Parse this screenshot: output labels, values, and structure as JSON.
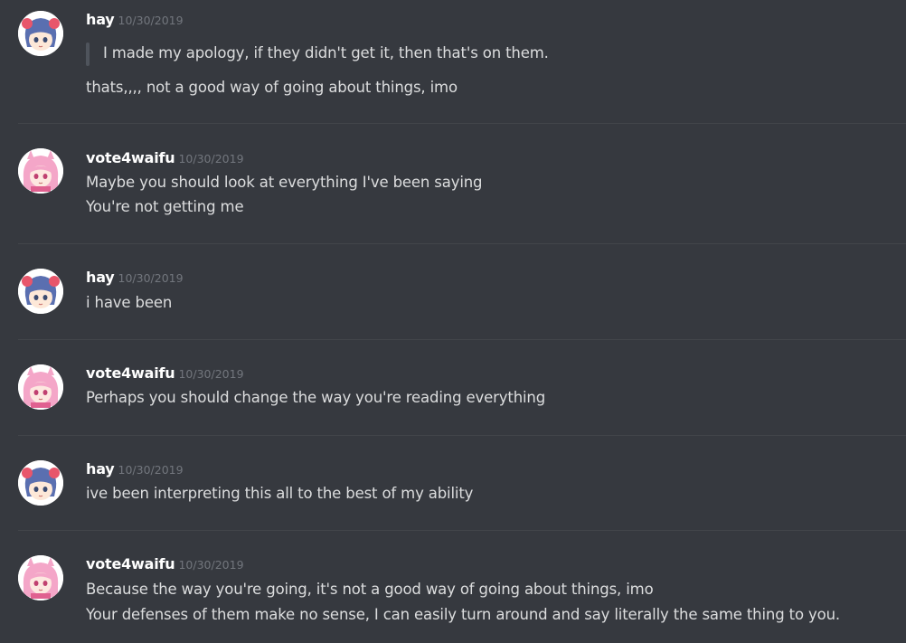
{
  "messages": [
    {
      "author": "hay",
      "timestamp": "10/30/2019",
      "avatar_icon": "hay-avatar-icon",
      "quote": "I made my apology, if they didn't get it, then that's on them.",
      "lines": [
        "thats,,,, not a good way of going about things, imo"
      ]
    },
    {
      "author": "vote4waifu",
      "timestamp": "10/30/2019",
      "avatar_icon": "vote4waifu-avatar-icon",
      "lines": [
        "Maybe you should look at everything I've been saying",
        "You're not getting me"
      ]
    },
    {
      "author": "hay",
      "timestamp": "10/30/2019",
      "avatar_icon": "hay-avatar-icon",
      "lines": [
        "i have been"
      ]
    },
    {
      "author": "vote4waifu",
      "timestamp": "10/30/2019",
      "avatar_icon": "vote4waifu-avatar-icon",
      "lines": [
        "Perhaps you should change the way you're reading everything"
      ]
    },
    {
      "author": "hay",
      "timestamp": "10/30/2019",
      "avatar_icon": "hay-avatar-icon",
      "lines": [
        "ive been interpreting this all to the best of my ability"
      ]
    },
    {
      "author": "vote4waifu",
      "timestamp": "10/30/2019",
      "avatar_icon": "vote4waifu-avatar-icon",
      "lines": [
        "Because the way you're going, it's not a good way of going about things, imo",
        "Your defenses of them make no sense, I can easily turn around and say literally the same thing to you."
      ]
    }
  ],
  "colors": {
    "background": "#36393f",
    "username": "#ffffff",
    "timestamp": "#72767d",
    "text": "#dcddde",
    "quote_bar": "#4f545c",
    "divider": "#42454a"
  }
}
